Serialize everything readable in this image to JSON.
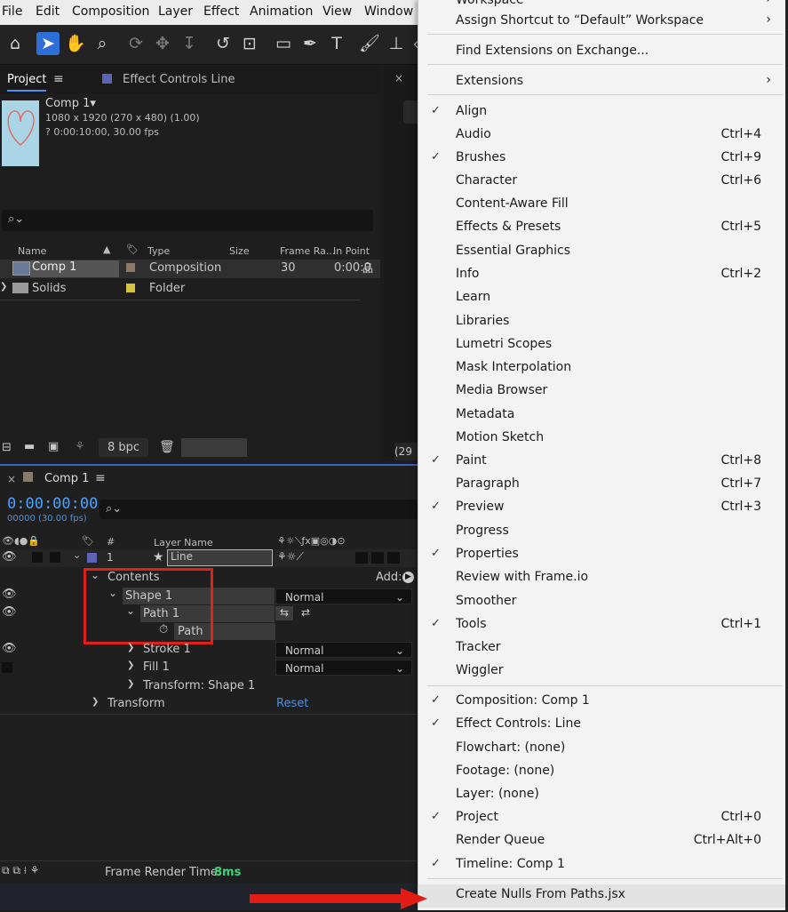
{
  "menubar": {
    "items": [
      "File",
      "Edit",
      "Composition",
      "Layer",
      "Effect",
      "Animation",
      "View",
      "Window"
    ]
  },
  "project_panel": {
    "tab_project": "Project",
    "tab_effect_controls": "Effect Controls Line",
    "comp_name": "Comp 1▾",
    "comp_dims": "1080 x 1920  (270 x 480) (1.00)",
    "comp_duration": "? 0:00:10:00, 30.00 fps",
    "columns": [
      "Name",
      "Type",
      "Size",
      "Frame Ra...",
      "In Point"
    ],
    "rows": [
      {
        "name": "Comp 1",
        "type": "Composition",
        "frame_rate": "30",
        "in_point": "0:00:0"
      },
      {
        "name": "Solids",
        "type": "Folder"
      }
    ],
    "bpc": "8 bpc"
  },
  "viewer": {
    "zoom_fragment": "(29"
  },
  "timeline": {
    "tab": "Comp 1",
    "timecode": "0:00:00:00",
    "frames": "00000 (30.00 fps)",
    "layer_name_header": "Layer Name",
    "layer_num": "1",
    "layer_name": "Line",
    "contents": "Contents",
    "add_label": "Add:",
    "shape": "Shape 1",
    "path_group": "Path 1",
    "path": "Path",
    "stroke": "Stroke 1",
    "fill": "Fill 1",
    "transform_shape": "Transform: Shape 1",
    "transform": "Transform",
    "reset": "Reset",
    "blend_mode": "Normal",
    "render_label": "Frame Render Time:",
    "render_value": "8ms"
  },
  "dropdown": {
    "items": [
      {
        "label": "Workspace",
        "checked": false,
        "shortcut": "",
        "submenu": true
      },
      {
        "label": "Assign Shortcut to “Default” Workspace",
        "checked": false,
        "shortcut": "",
        "submenu": true
      },
      {
        "label": "Find Extensions on Exchange...",
        "checked": false,
        "shortcut": "",
        "submenu": false
      },
      {
        "label": "Extensions",
        "checked": false,
        "shortcut": "",
        "submenu": true
      },
      {
        "label": "Align",
        "checked": true,
        "shortcut": ""
      },
      {
        "label": "Audio",
        "checked": false,
        "shortcut": "Ctrl+4"
      },
      {
        "label": "Brushes",
        "checked": true,
        "shortcut": "Ctrl+9"
      },
      {
        "label": "Character",
        "checked": false,
        "shortcut": "Ctrl+6"
      },
      {
        "label": "Content-Aware Fill",
        "checked": false,
        "shortcut": ""
      },
      {
        "label": "Effects & Presets",
        "checked": false,
        "shortcut": "Ctrl+5"
      },
      {
        "label": "Essential Graphics",
        "checked": false,
        "shortcut": ""
      },
      {
        "label": "Info",
        "checked": false,
        "shortcut": "Ctrl+2"
      },
      {
        "label": "Learn",
        "checked": false,
        "shortcut": ""
      },
      {
        "label": "Libraries",
        "checked": false,
        "shortcut": ""
      },
      {
        "label": "Lumetri Scopes",
        "checked": false,
        "shortcut": ""
      },
      {
        "label": "Mask Interpolation",
        "checked": false,
        "shortcut": ""
      },
      {
        "label": "Media Browser",
        "checked": false,
        "shortcut": ""
      },
      {
        "label": "Metadata",
        "checked": false,
        "shortcut": ""
      },
      {
        "label": "Motion Sketch",
        "checked": false,
        "shortcut": ""
      },
      {
        "label": "Paint",
        "checked": true,
        "shortcut": "Ctrl+8"
      },
      {
        "label": "Paragraph",
        "checked": false,
        "shortcut": "Ctrl+7"
      },
      {
        "label": "Preview",
        "checked": true,
        "shortcut": "Ctrl+3"
      },
      {
        "label": "Progress",
        "checked": false,
        "shortcut": ""
      },
      {
        "label": "Properties",
        "checked": true,
        "shortcut": ""
      },
      {
        "label": "Review with Frame.io",
        "checked": false,
        "shortcut": ""
      },
      {
        "label": "Smoother",
        "checked": false,
        "shortcut": ""
      },
      {
        "label": "Tools",
        "checked": true,
        "shortcut": "Ctrl+1"
      },
      {
        "label": "Tracker",
        "checked": false,
        "shortcut": ""
      },
      {
        "label": "Wiggler",
        "checked": false,
        "shortcut": ""
      },
      {
        "label": "Composition: Comp 1",
        "checked": true,
        "shortcut": ""
      },
      {
        "label": "Effect Controls: Line",
        "checked": true,
        "shortcut": ""
      },
      {
        "label": "Flowchart: (none)",
        "checked": false,
        "shortcut": ""
      },
      {
        "label": "Footage: (none)",
        "checked": false,
        "shortcut": ""
      },
      {
        "label": "Layer: (none)",
        "checked": false,
        "shortcut": ""
      },
      {
        "label": "Project",
        "checked": true,
        "shortcut": "Ctrl+0"
      },
      {
        "label": "Render Queue",
        "checked": false,
        "shortcut": "Ctrl+Alt+0"
      },
      {
        "label": "Timeline: Comp 1",
        "checked": true,
        "shortcut": ""
      },
      {
        "label": "Create Nulls From Paths.jsx",
        "checked": false,
        "shortcut": ""
      }
    ]
  },
  "colors": {
    "accent": "#2d6fd6",
    "highlight_box": "#e0201c",
    "arrow": "#e21b14",
    "timecode": "#4aa3ff",
    "render_value": "#3fd17a"
  }
}
